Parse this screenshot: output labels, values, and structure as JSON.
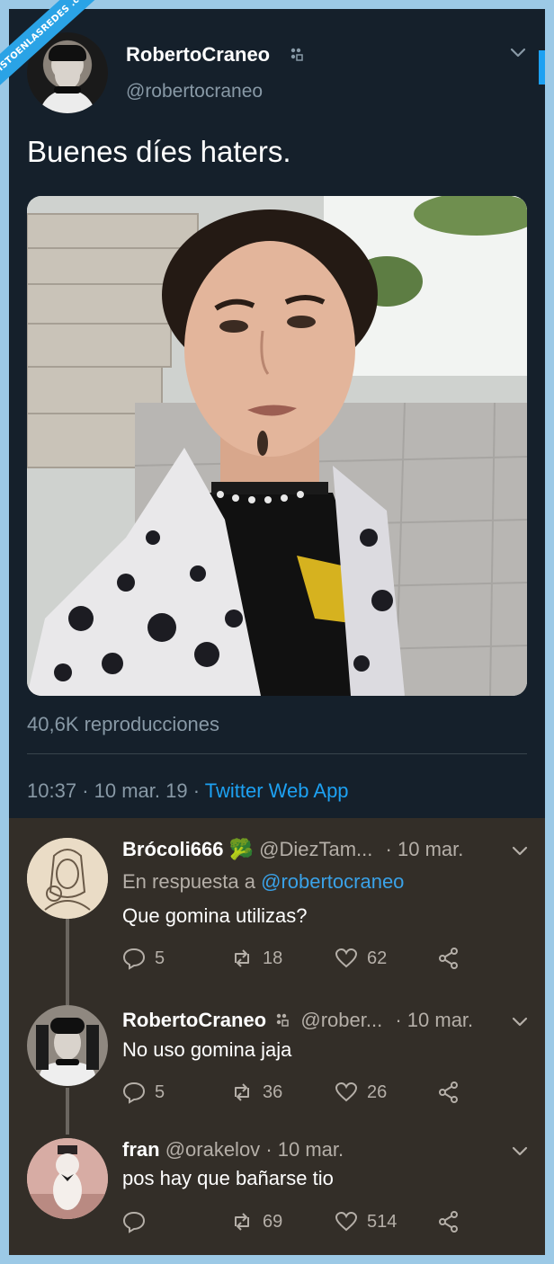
{
  "watermark": {
    "text": "VISTOENLASREDES .com"
  },
  "main_tweet": {
    "author_name": "RobertoCraneo",
    "author_handle": "@robertocraneo",
    "text": "Buenes díes haters.",
    "views": "40,6K reproducciones",
    "time": "10:37",
    "date": "10 mar. 19",
    "separator": "·",
    "source": "Twitter Web App"
  },
  "replies": [
    {
      "name": "Brócoli666",
      "name_emoji": "🥦",
      "handle": "@DiezTam...",
      "separator": "·",
      "date": "10 mar.",
      "in_reply_prefix": "En respuesta a",
      "in_reply_handle": "@robertocraneo",
      "text": "Que gomina utilizas?",
      "replies": "5",
      "retweets": "18",
      "likes": "62"
    },
    {
      "name": "RobertoCraneo",
      "handle": "@rober...",
      "separator": "·",
      "date": "10 mar.",
      "text": "No uso gomina jaja",
      "replies": "5",
      "retweets": "36",
      "likes": "26"
    },
    {
      "name": "fran",
      "handle": "@orakelov",
      "separator": "·",
      "date": "10 mar.",
      "text": "pos hay que bañarse tio",
      "replies": "",
      "retweets": "69",
      "likes": "514"
    }
  ],
  "colors": {
    "main_bg": "#15202b",
    "replies_bg": "#332e28",
    "accent": "#1da1f2",
    "muted": "#8899a6"
  }
}
